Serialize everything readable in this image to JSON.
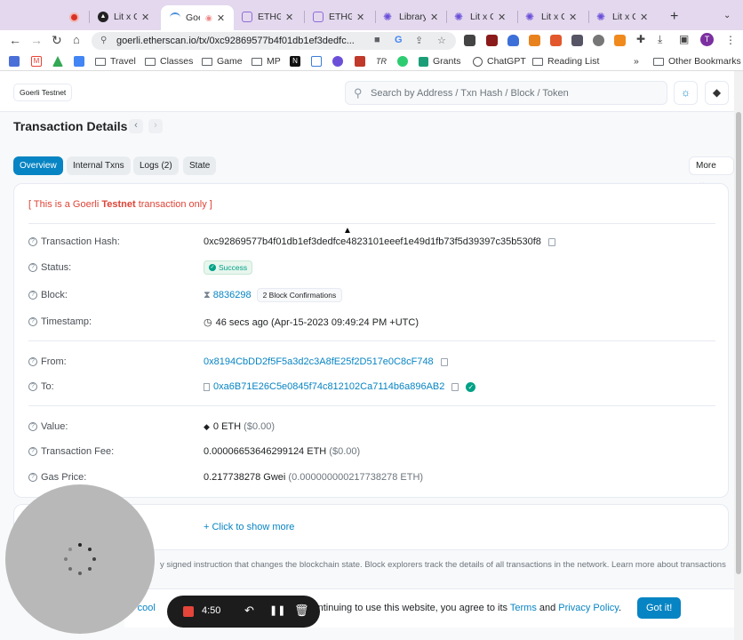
{
  "browser": {
    "tabs": [
      {
        "label": "",
        "icon": "record-icon",
        "color": "#d93025"
      },
      {
        "label": "Lit x Go",
        "icon": "triangle-icon",
        "color": "#222222"
      },
      {
        "label": "Goerli",
        "icon": "loading-icon",
        "color": "#4a90d9",
        "active": true
      },
      {
        "label": "ETHGlo",
        "icon": "ethglobal-icon",
        "color": "#8f6bd8"
      },
      {
        "label": "ETHGlo",
        "icon": "ethglobal-icon",
        "color": "#8f6bd8"
      },
      {
        "label": "Library",
        "icon": "gear-icon",
        "color": "#6b4fd8"
      },
      {
        "label": "Lit x Go",
        "icon": "gear-icon",
        "color": "#6b4fd8"
      },
      {
        "label": "Lit x Go",
        "icon": "gear-icon",
        "color": "#6b4fd8"
      },
      {
        "label": "Lit x Go",
        "icon": "gear-icon",
        "color": "#6b4fd8"
      }
    ],
    "url": "goerli.etherscan.io/tx/0xc92869577b4f01db1ef3dedfc...",
    "avatar_initial": "T",
    "bookmarks": [
      "Travel",
      "Classes",
      "Game",
      "MP",
      "Grants",
      "ChatGPT",
      "Reading List"
    ],
    "more_bookmarks": "»",
    "other_bookmarks": "Other Bookmarks"
  },
  "header": {
    "network_badge": "Goerli Testnet",
    "search_placeholder": "Search by Address / Txn Hash / Block / Token"
  },
  "page": {
    "title": "Transaction Details",
    "tabs": [
      "Overview",
      "Internal Txns",
      "Logs (2)",
      "State"
    ],
    "more_label": "More",
    "notice_prefix": "[ This is a Goerli ",
    "notice_bold": "Testnet",
    "notice_suffix": " transaction only ]"
  },
  "details": {
    "tx_hash_label": "Transaction Hash:",
    "tx_hash": "0xc92869577b4f01db1ef3dedfce4823101eeef1e49d1fb73f5d39397c35b530f8",
    "status_label": "Status:",
    "status": "Success",
    "block_label": "Block:",
    "block": "8836298",
    "block_confirmations": "2 Block Confirmations",
    "timestamp_label": "Timestamp:",
    "timestamp": "46 secs ago (Apr-15-2023 09:49:24 PM +UTC)",
    "from_label": "From:",
    "from": "0x8194CbDD2f5F5a3d2c3A8fE25f2D517e0C8cF748",
    "to_label": "To:",
    "to": "0xa6B71E26C5e0845f74c812102Ca7114b6a896AB2",
    "value_label": "Value:",
    "value": "0 ETH",
    "value_usd": "($0.00)",
    "fee_label": "Transaction Fee:",
    "fee": "0.00006653646299124 ETH",
    "fee_usd": "($0.00)",
    "gas_label": "Gas Price:",
    "gas": "0.217738278 Gwei",
    "gas_eth": "(0.000000000217738278 ETH)",
    "show_more": "+ Click to show more"
  },
  "footnote": "y signed instruction that changes the blockchain state. Block explorers track the details of all transactions in the network. Learn more about transactions",
  "cookie": {
    "partial": "es cool",
    "text": "continuing to use this website, you agree to its ",
    "terms": "Terms",
    "and": " and ",
    "privacy": "Privacy Policy",
    "period": ".",
    "button": "Got it!"
  },
  "recorder": {
    "time": "4:50"
  }
}
